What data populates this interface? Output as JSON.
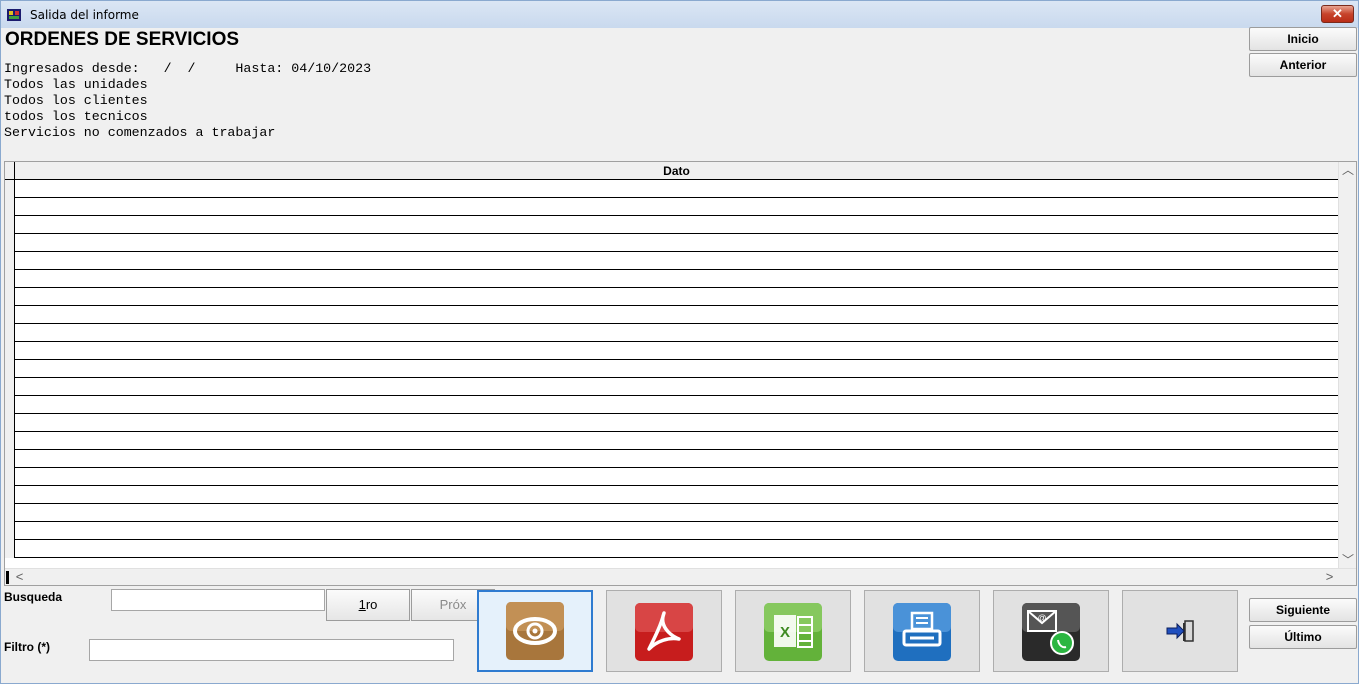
{
  "window": {
    "title": "Salida del informe",
    "close_label": "✕"
  },
  "report": {
    "title": "ORDENES DE SERVICIOS",
    "params": [
      "Ingresados desde:   /  /     Hasta: 04/10/2023",
      "Todos las unidades",
      "Todos los clientes",
      "todos los tecnicos",
      "Servicios no comenzados a trabajar"
    ]
  },
  "nav": {
    "inicio": "Inicio",
    "anterior": "Anterior",
    "siguiente": "Siguiente",
    "ultimo": "Último"
  },
  "grid": {
    "column": "Dato",
    "row_count": 21
  },
  "search": {
    "label": "Busqueda",
    "value": "",
    "first_label": "1ro",
    "next_label": "Próx"
  },
  "filter": {
    "label": "Filtro (*)",
    "value": ""
  },
  "actions": [
    {
      "name": "view-icon",
      "color": "#a8763c"
    },
    {
      "name": "pdf-icon",
      "color": "#c71d1d"
    },
    {
      "name": "excel-icon",
      "color": "#63b23a"
    },
    {
      "name": "print-icon",
      "color": "#1f6fbf"
    },
    {
      "name": "email-whatsapp-icon",
      "color": "#2a2a2a"
    },
    {
      "name": "exit-icon",
      "color": "#1f4fbf"
    }
  ]
}
